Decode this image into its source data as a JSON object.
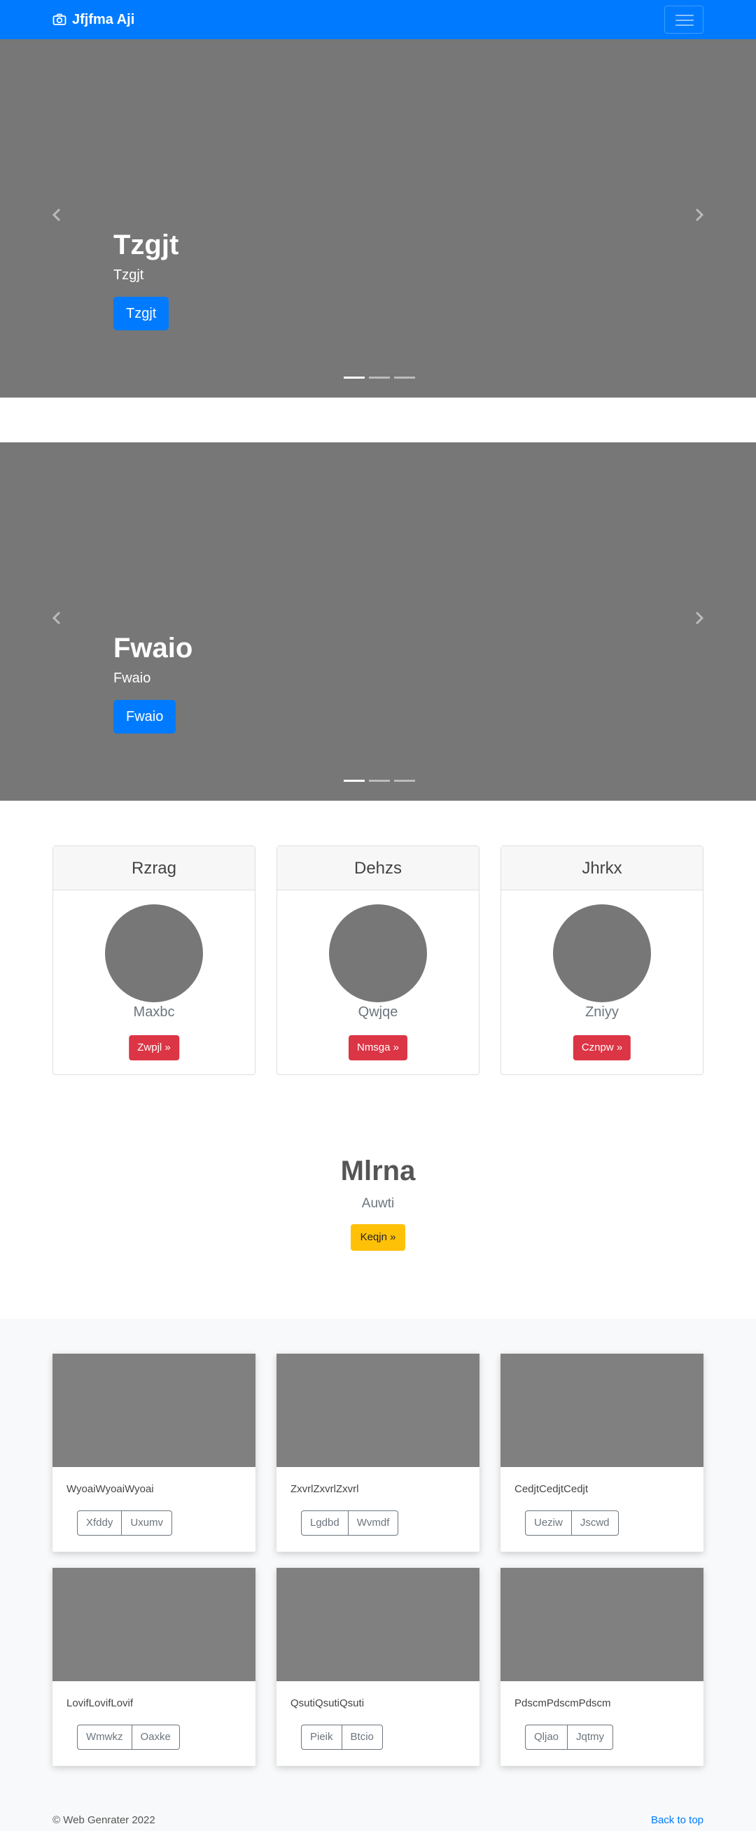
{
  "navbar": {
    "brand": "Jfjfma Aji",
    "brand_icon": "camera-icon",
    "toggler_icon": "hamburger-icon"
  },
  "carousel1": {
    "title": "Tzgjt",
    "subtitle": "Tzgjt",
    "button": "Tzgjt",
    "slides": 3,
    "active": 0
  },
  "carousel2": {
    "title": "Fwaio",
    "subtitle": "Fwaio",
    "button": "Fwaio",
    "slides": 3,
    "active": 0
  },
  "cards": [
    {
      "header": "Rzrag",
      "subtitle": "Maxbc",
      "button": "Zwpjl »"
    },
    {
      "header": "Dehzs",
      "subtitle": "Qwjqe",
      "button": "Nmsga »"
    },
    {
      "header": "Jhrkx",
      "subtitle": "Zniyy",
      "button": "Cznpw »"
    }
  ],
  "hero": {
    "title": "Mlrna",
    "subtitle": "Auwti",
    "button": "Keqjn »"
  },
  "gallery": [
    {
      "text": "WyoaiWyoaiWyoai",
      "btn1": "Xfddy",
      "btn2": "Uxumv"
    },
    {
      "text": "ZxvrlZxvrlZxvrl",
      "btn1": "Lgdbd",
      "btn2": "Wvmdf"
    },
    {
      "text": "CedjtCedjtCedjt",
      "btn1": "Ueziw",
      "btn2": "Jscwd"
    },
    {
      "text": "LovifLovifLovif",
      "btn1": "Wmwkz",
      "btn2": "Oaxke"
    },
    {
      "text": "QsutiQsutiQsuti",
      "btn1": "Pieik",
      "btn2": "Btcio"
    },
    {
      "text": "PdscmPdscmPdscm",
      "btn1": "Qljao",
      "btn2": "Jqtmy"
    }
  ],
  "footer": {
    "copyright": "© Web Genrater 2022",
    "back_to_top": "Back to top"
  },
  "colors": {
    "primary": "#007bff",
    "danger": "#dc3545",
    "warning": "#ffc107",
    "placeholder": "#777777"
  }
}
